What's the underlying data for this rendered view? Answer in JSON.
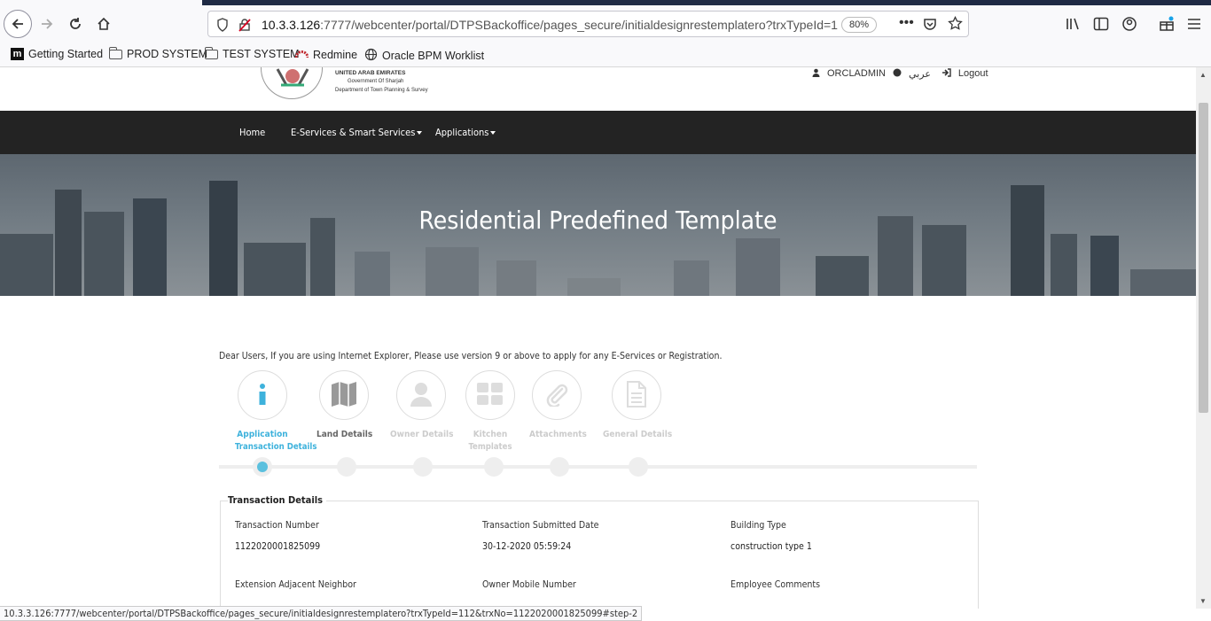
{
  "browser": {
    "url_host": "10.3.3.126",
    "url_rest": ":7777/webcenter/portal/DTPSBackoffice/pages_secure/initialdesignrestemplatero?trxTypeId=112",
    "zoom": "80%",
    "bookmarks": [
      {
        "label": "Getting Started"
      },
      {
        "label": "PROD SYSTEM"
      },
      {
        "label": "TEST SYSTEM"
      },
      {
        "label": "Redmine"
      },
      {
        "label": "Oracle BPM Worklist"
      }
    ],
    "status_url": "10.3.3.126:7777/webcenter/portal/DTPSBackoffice/pages_secure/initialdesignrestemplatero?trxTypeId=112&trxNo=1122020001825099#step-2"
  },
  "header": {
    "logo_lines": [
      "UNITED ARAB EMIRATES",
      "Government Of Sharjah",
      "Department of Town Planning & Survey"
    ],
    "username": "ORCLADMIN",
    "language": "عربي",
    "logout": "Logout"
  },
  "nav": {
    "home": "Home",
    "eservices": "E-Services & Smart Services",
    "applications": "Applications"
  },
  "banner": {
    "title": "Residential Predefined Template"
  },
  "notice": "Dear Users, If you are using Internet Explorer, Please use version 9 or above to apply for any E-Services or Registration.",
  "steps": [
    {
      "label": "Application",
      "sub": "Transaction Details",
      "icon": "info-icon"
    },
    {
      "label": "Land Details",
      "sub": "",
      "icon": "map-icon"
    },
    {
      "label": "Owner Details",
      "sub": "",
      "icon": "user-icon"
    },
    {
      "label": "Kitchen",
      "sub": "Templates",
      "icon": "grid-icon"
    },
    {
      "label": "Attachments",
      "sub": "",
      "icon": "paperclip-icon"
    },
    {
      "label": "General Details",
      "sub": "",
      "icon": "document-icon"
    }
  ],
  "details": {
    "legend": "Transaction Details",
    "fields": [
      {
        "label": "Transaction Number",
        "value": "1122020001825099"
      },
      {
        "label": "Transaction Submitted Date",
        "value": "30-12-2020 05:59:24"
      },
      {
        "label": "Building Type",
        "value": "construction type 1"
      },
      {
        "label": "Extension Adjacent Neighbor",
        "value": ""
      },
      {
        "label": "Owner Mobile Number",
        "value": ""
      },
      {
        "label": "Employee Comments",
        "value": ""
      }
    ]
  },
  "colors": {
    "accent": "#3eb2dc",
    "navbar": "#232323"
  }
}
